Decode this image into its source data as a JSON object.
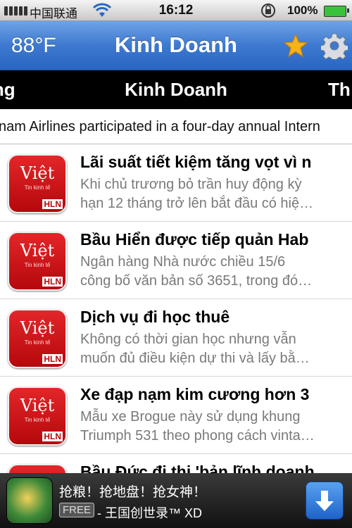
{
  "status_bar": {
    "carrier": "中国联通",
    "time": "16:12",
    "battery": "100%"
  },
  "nav": {
    "temperature": "88°F",
    "title": "Kinh Doanh",
    "star_icon": "star-icon",
    "gear_icon": "gear-icon"
  },
  "categories": {
    "left": "ong",
    "center": "Kinh Doanh",
    "right": "Th"
  },
  "ticker": {
    "text": "nam Airlines participated in a four-day annual Intern"
  },
  "articles": [
    {
      "title": "Lãi suất tiết kiệm tăng vọt vì n",
      "desc_line1": "Khi chủ trương bỏ trần huy động kỳ",
      "desc_line2": "hạn 12 tháng trở lên bắt đầu có hiệ…"
    },
    {
      "title": "Bầu Hiển được tiếp quản Hab",
      "desc_line1": "Ngân hàng Nhà nước chiều 15/6",
      "desc_line2": "công bố văn bản số 3651, trong đó…"
    },
    {
      "title": "Dịch vụ đi học thuê",
      "desc_line1": "Không có thời gian học nhưng vẫn",
      "desc_line2": "muốn đủ điều kiện dự thi và lấy bằ…"
    },
    {
      "title": "Xe đạp nạm kim cương hơn 3",
      "desc_line1": "Mẫu xe Brogue này sử dụng khung",
      "desc_line2": "Triumph 531 theo phong cách vinta…"
    },
    {
      "title": "Bầu Đức đi thi 'bản lĩnh doanh",
      "desc_line1": "",
      "desc_line2": ""
    }
  ],
  "thumb": {
    "logo_text": "Việt",
    "subtitle": "Tin kinh tế",
    "badge": "HLN"
  },
  "ad": {
    "title": "抢粮！抢地盘！抢女神！",
    "free_label": "FREE",
    "app_name": "- 王国创世录™ XD"
  },
  "colors": {
    "nav_blue": "#3d79cf",
    "thumb_red": "#d0161a",
    "category_bg": "#000000"
  }
}
